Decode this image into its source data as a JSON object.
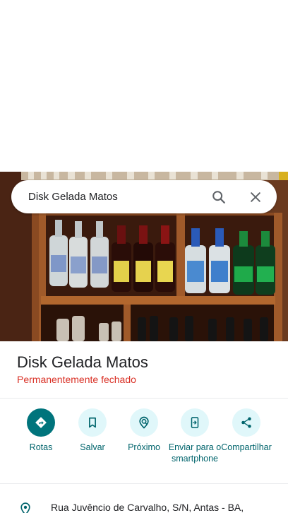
{
  "search": {
    "query": "Disk Gelada Matos"
  },
  "place": {
    "name": "Disk Gelada Matos",
    "status": "Permanentemente fechado",
    "address": "Rua Juvêncio de Carvalho, S/N, Antas - BA,"
  },
  "actions": [
    {
      "label": "Rotas",
      "icon": "directions-icon"
    },
    {
      "label": "Salvar",
      "icon": "bookmark-icon"
    },
    {
      "label": "Próximo",
      "icon": "nearby-icon"
    },
    {
      "label": "Enviar para o smartphone",
      "icon": "send-to-phone-icon"
    },
    {
      "label": "Compartilhar",
      "icon": "share-icon"
    }
  ],
  "colors": {
    "accent": "#00747c",
    "accent_light": "#e0f7fa",
    "status_closed": "#d93025",
    "label_teal": "#00646c"
  }
}
